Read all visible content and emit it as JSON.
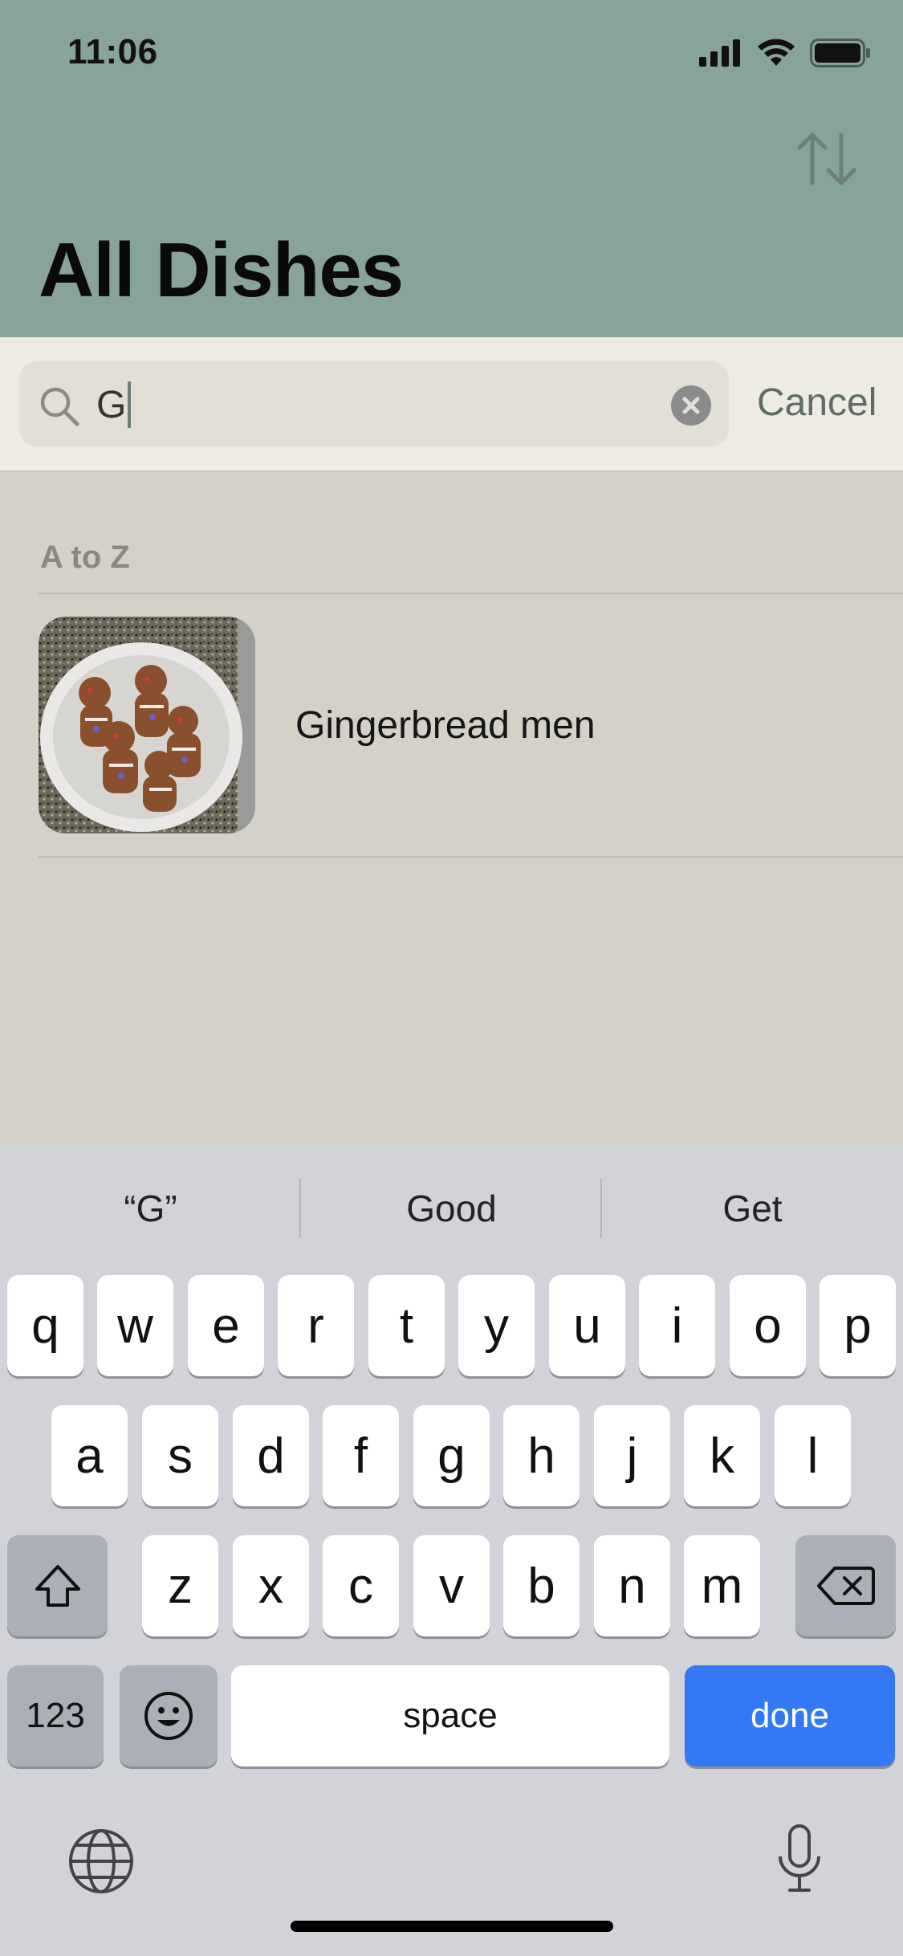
{
  "status_bar": {
    "time": "11:06"
  },
  "header": {
    "title": "All Dishes",
    "sort_icon": "sort-arrows-icon"
  },
  "search": {
    "value": "G",
    "cancel_label": "Cancel"
  },
  "list": {
    "section_title": "A to Z",
    "items": [
      {
        "name": "Gingerbread men"
      }
    ]
  },
  "keyboard": {
    "suggestions": [
      "“G”",
      "Good",
      "Get"
    ],
    "row1": [
      "q",
      "w",
      "e",
      "r",
      "t",
      "y",
      "u",
      "i",
      "o",
      "p"
    ],
    "row2": [
      "a",
      "s",
      "d",
      "f",
      "g",
      "h",
      "j",
      "k",
      "l"
    ],
    "row3": [
      "z",
      "x",
      "c",
      "v",
      "b",
      "n",
      "m"
    ],
    "numbers_label": "123",
    "space_label": "space",
    "done_label": "done"
  },
  "colors": {
    "header_bg": "#88a39b",
    "search_bg": "#eeebe2",
    "list_bg": "#d4d1c9",
    "done_key": "#3478f6"
  }
}
